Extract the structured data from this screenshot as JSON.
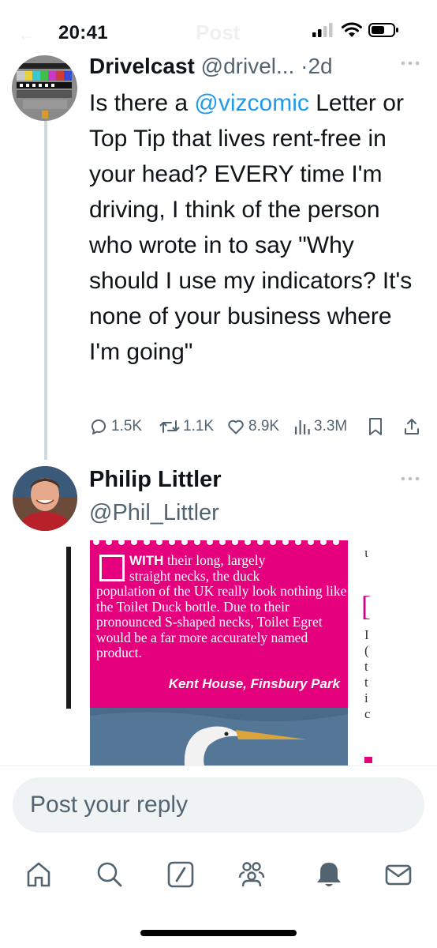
{
  "status_bar": {
    "time": "20:41",
    "faded_title": "Post"
  },
  "colors": {
    "accent": "#1d9bf0",
    "text": "#0f1419",
    "muted": "#536471",
    "magazine_pink": "#e5007e"
  },
  "tweet1": {
    "author_name": "Drivelcast",
    "handle": "@drivel...",
    "separator": "·",
    "time_ago": "2d",
    "text_before_mention": "Is there a ",
    "mention": "@vizcomic",
    "text_after_mention": " Letter or Top Tip that lives rent-free in your head? EVERY time I'm driving, I think of the person who wrote in to say \"Why should I use my indicators? It's none of your business where I'm going\"",
    "replies": "1.5K",
    "reposts": "1.1K",
    "likes": "8.9K",
    "views": "3.3M"
  },
  "tweet2": {
    "author_name": "Philip Littler",
    "handle": "@Phil_Littler",
    "media": {
      "lead_word": "WITH",
      "line1_rest": " their long, largely",
      "line2": "straight necks, the duck",
      "body": "population of the UK really look nothing like the Toilet Duck bottle. Due to their pronounced S-shaped necks, Toilet Egret would be a far more accurately named product.",
      "signature": "Kent House, Finsbury Park",
      "side_letters": [
        "ι",
        "[",
        "I",
        "(",
        "t",
        "t",
        "i",
        "c"
      ]
    }
  },
  "reply": {
    "placeholder": "Post your reply"
  },
  "tabs": [
    "home-icon",
    "search-icon",
    "grok-icon",
    "communities-icon",
    "notifications-icon",
    "messages-icon"
  ]
}
